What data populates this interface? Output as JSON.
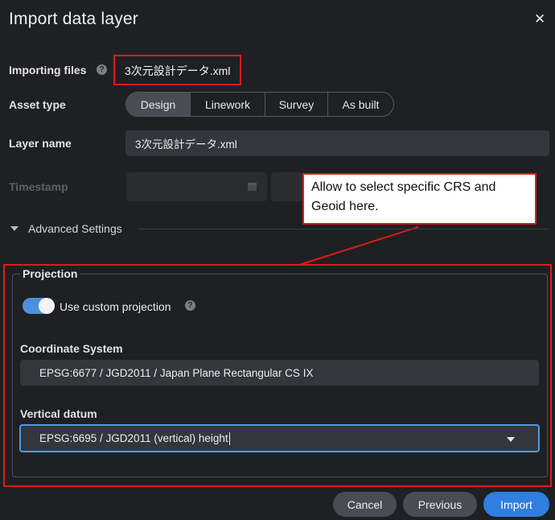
{
  "dialog": {
    "title": "Import data layer"
  },
  "importing": {
    "label": "Importing files",
    "filename": "3次元設計データ.xml"
  },
  "asset_type": {
    "label": "Asset type",
    "options": [
      "Design",
      "Linework",
      "Survey",
      "As built"
    ],
    "selected": "Design"
  },
  "layer_name": {
    "label": "Layer name",
    "value": "3次元設計データ.xml"
  },
  "timestamp": {
    "label": "Timestamp"
  },
  "callout": {
    "text": "Allow to select specific CRS and Geoid here."
  },
  "advanced": {
    "label": "Advanced Settings"
  },
  "projection": {
    "legend": "Projection",
    "toggle_label": "Use custom projection",
    "toggle_on": true,
    "crs_label": "Coordinate System",
    "crs_value": "EPSG:6677 / JGD2011 / Japan Plane Rectangular CS IX",
    "vdatum_label": "Vertical datum",
    "vdatum_value": "EPSG:6695 / JGD2011 (vertical) height"
  },
  "footer": {
    "cancel": "Cancel",
    "previous": "Previous",
    "import": "Import"
  },
  "colors": {
    "accent": "#2f7ee0",
    "highlight": "#e01a1a",
    "toggle": "#4e8fdc"
  }
}
